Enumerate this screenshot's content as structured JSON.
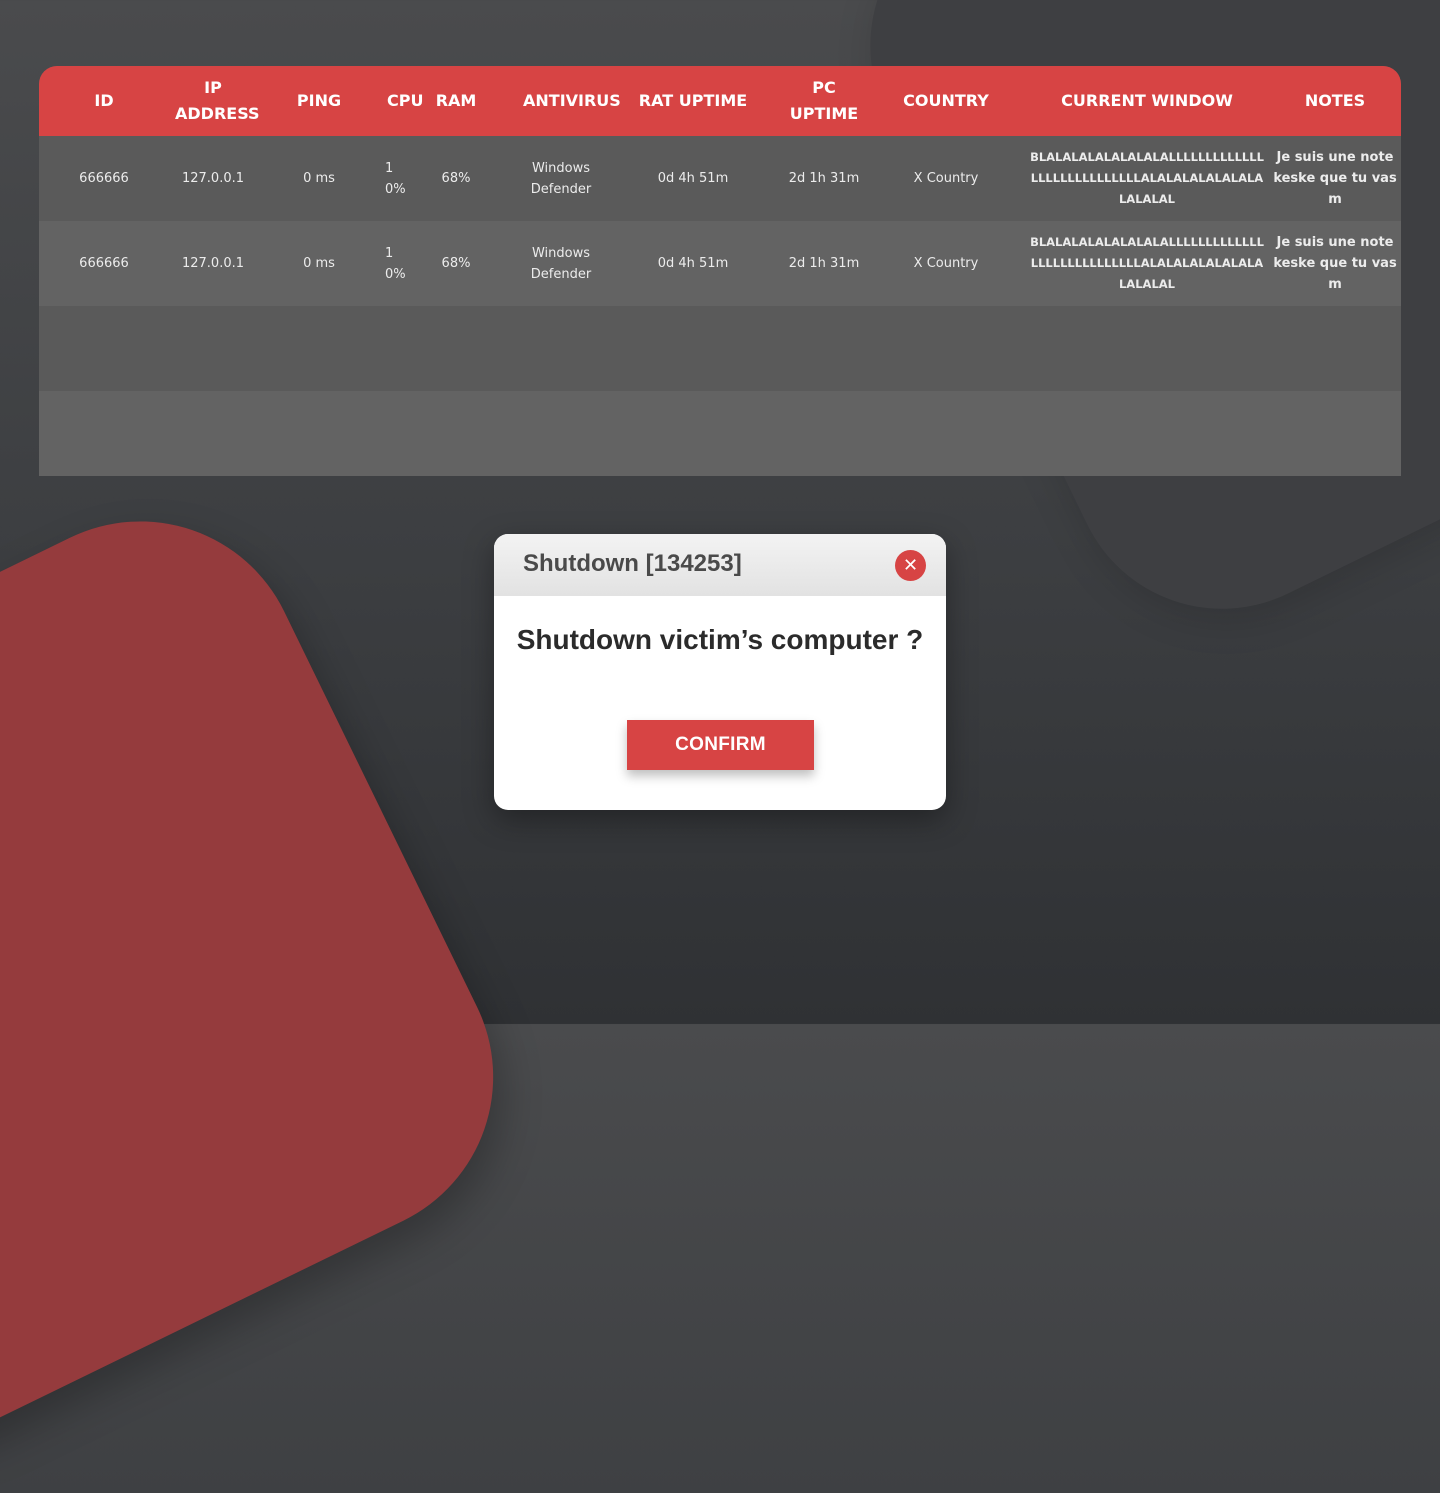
{
  "table": {
    "headers": [
      "ID",
      "IP ADDRESS",
      "PING",
      "CPU",
      "RAM",
      "ANTIVIRUS",
      "RAT UPTIME",
      "PC UPTIME",
      "COUNTRY",
      "CURRENT WINDOW",
      "NOTES"
    ],
    "rows": [
      {
        "id": "666666",
        "ip": "127.0.0.1",
        "ping": "0 ms",
        "cpu": "10%",
        "ram": "68%",
        "antivirus": "Windows Defender",
        "rat_uptime": "0d 4h 51m",
        "pc_uptime": "2d 1h 31m",
        "country": "X Country",
        "current_window": "BLALALALALALALALALLLLLLLLLLLLLLLLLLLLLLLLLLLLALALALALALALALALALALAL",
        "notes": "Je suis une note keske que tu vas m"
      },
      {
        "id": "666666",
        "ip": "127.0.0.1",
        "ping": "0 ms",
        "cpu": "10%",
        "ram": "68%",
        "antivirus": "Windows Defender",
        "rat_uptime": "0d 4h 51m",
        "pc_uptime": "2d 1h 31m",
        "country": "X Country",
        "current_window": "BLALALALALALALALALLLLLLLLLLLLLLLLLLLLLLLLLLLLALALALALALALALALALALAL",
        "notes": "Je suis une note keske que tu vas m"
      }
    ]
  },
  "modal": {
    "title": "Shutdown [134253]",
    "close_icon": "close-icon",
    "question": "Shutdown victim’s computer ?",
    "confirm_label": "CONFIRM"
  },
  "colors": {
    "accent": "#d74444",
    "background": "#3c3e41",
    "row_dark": "#5a5a5a",
    "row_light": "#636363",
    "decor_red": "#953b3d"
  }
}
